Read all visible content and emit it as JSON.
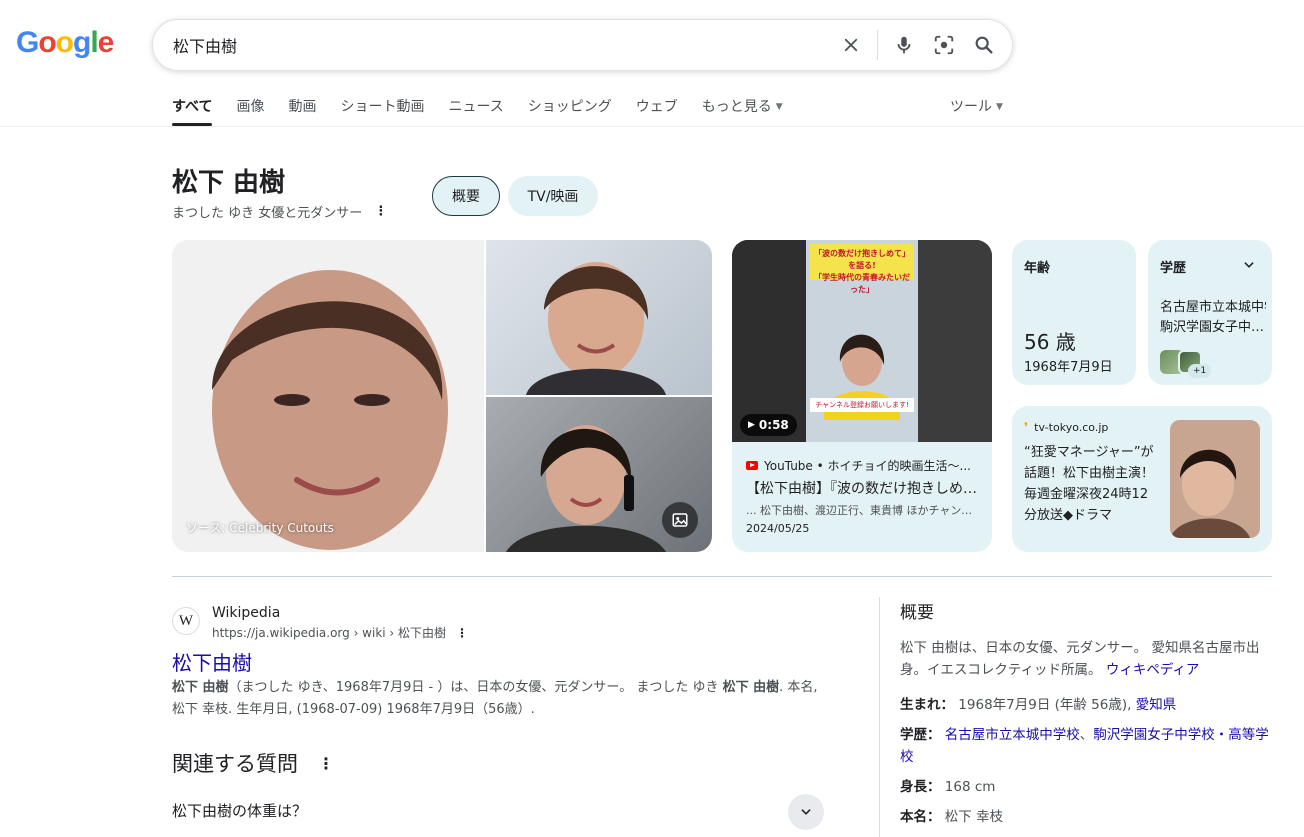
{
  "logo": {
    "text": "Google",
    "colors": [
      "#4285F4",
      "#EA4335",
      "#FBBC05",
      "#4285F4",
      "#34A853",
      "#EA4335"
    ]
  },
  "search": {
    "query": "松下由樹"
  },
  "tabs": [
    {
      "label": "すべて"
    },
    {
      "label": "画像"
    },
    {
      "label": "動画"
    },
    {
      "label": "ショート動画"
    },
    {
      "label": "ニュース"
    },
    {
      "label": "ショッピング"
    },
    {
      "label": "ウェブ"
    },
    {
      "label": "もっと見る"
    }
  ],
  "tools_label": "ツール",
  "kp": {
    "title": "松下 由樹",
    "subtitle": "まつした ゆき  女優と元ダンサー",
    "chips": [
      "概要",
      "TV/映画"
    ],
    "source_label": "ソース: Celebrity Cutouts",
    "video": {
      "duration": "0:58",
      "source": "YouTube • ホイチョイ的映画生活〜...",
      "title": "【松下由樹】『波の数だけ抱きしめて』を語る!",
      "desc": "... 松下由樹、渡辺正行、東貴博 ほかチャンネル登録",
      "date": "2024/05/25",
      "overlay_top": "「波の数だけ抱きしめて」を語る!",
      "overlay_sub": "「学生時代の青春みたいだった」",
      "overlay_bottom": "チャンネル登録お願いします!"
    },
    "age": {
      "label": "年齢",
      "value": "56 歳",
      "date": "1968年7月9日"
    },
    "education": {
      "label": "学歴",
      "line1": "名古屋市立本城中学校",
      "line2": "駒沢学園女子中学校・高等学校",
      "extra": "+1"
    },
    "tv": {
      "site": "tv-tokyo.co.jp",
      "text": "“狂愛マネージャー”が話題！松下由樹主演！毎週金曜深夜24時12分放送◆ドラマ"
    }
  },
  "result": {
    "site_name": "Wikipedia",
    "favicon": "W",
    "url": "https://ja.wikipedia.org › wiki › 松下由樹",
    "title": "松下由樹",
    "snippet_bold1": "松下 由樹",
    "snippet_part1": "（まつした ゆき、1968年7月9日 - ）は、日本の女優、元ダンサー。 まつした ゆき ",
    "snippet_bold2": "松下 由樹",
    "snippet_part2": ". 本名, 松下 幸枝. 生年月日, (1968-07-09) 1968年7月9日（56歳）."
  },
  "related": {
    "title": "関連する質問",
    "items": [
      "松下由樹の体重は？"
    ]
  },
  "panel": {
    "title": "概要",
    "desc": "松下 由樹は、日本の女優、元ダンサー。 愛知県名古屋市出身。イエスコレクティッド所属。 ",
    "desc_link": "ウィキペディア",
    "born_label": "生まれ：",
    "born_value": "1968年7月9日 (年齢 56歳), ",
    "born_link": "愛知県",
    "edu_label": "学歴：",
    "edu_link1": "名古屋市立本城中学校",
    "edu_sep": "、",
    "edu_link2": "駒沢学園女子中学校・高等学校",
    "height_label": "身長：",
    "height_value": "168 cm",
    "real_name_label": "本名：",
    "real_name_value": "松下 幸枝"
  }
}
